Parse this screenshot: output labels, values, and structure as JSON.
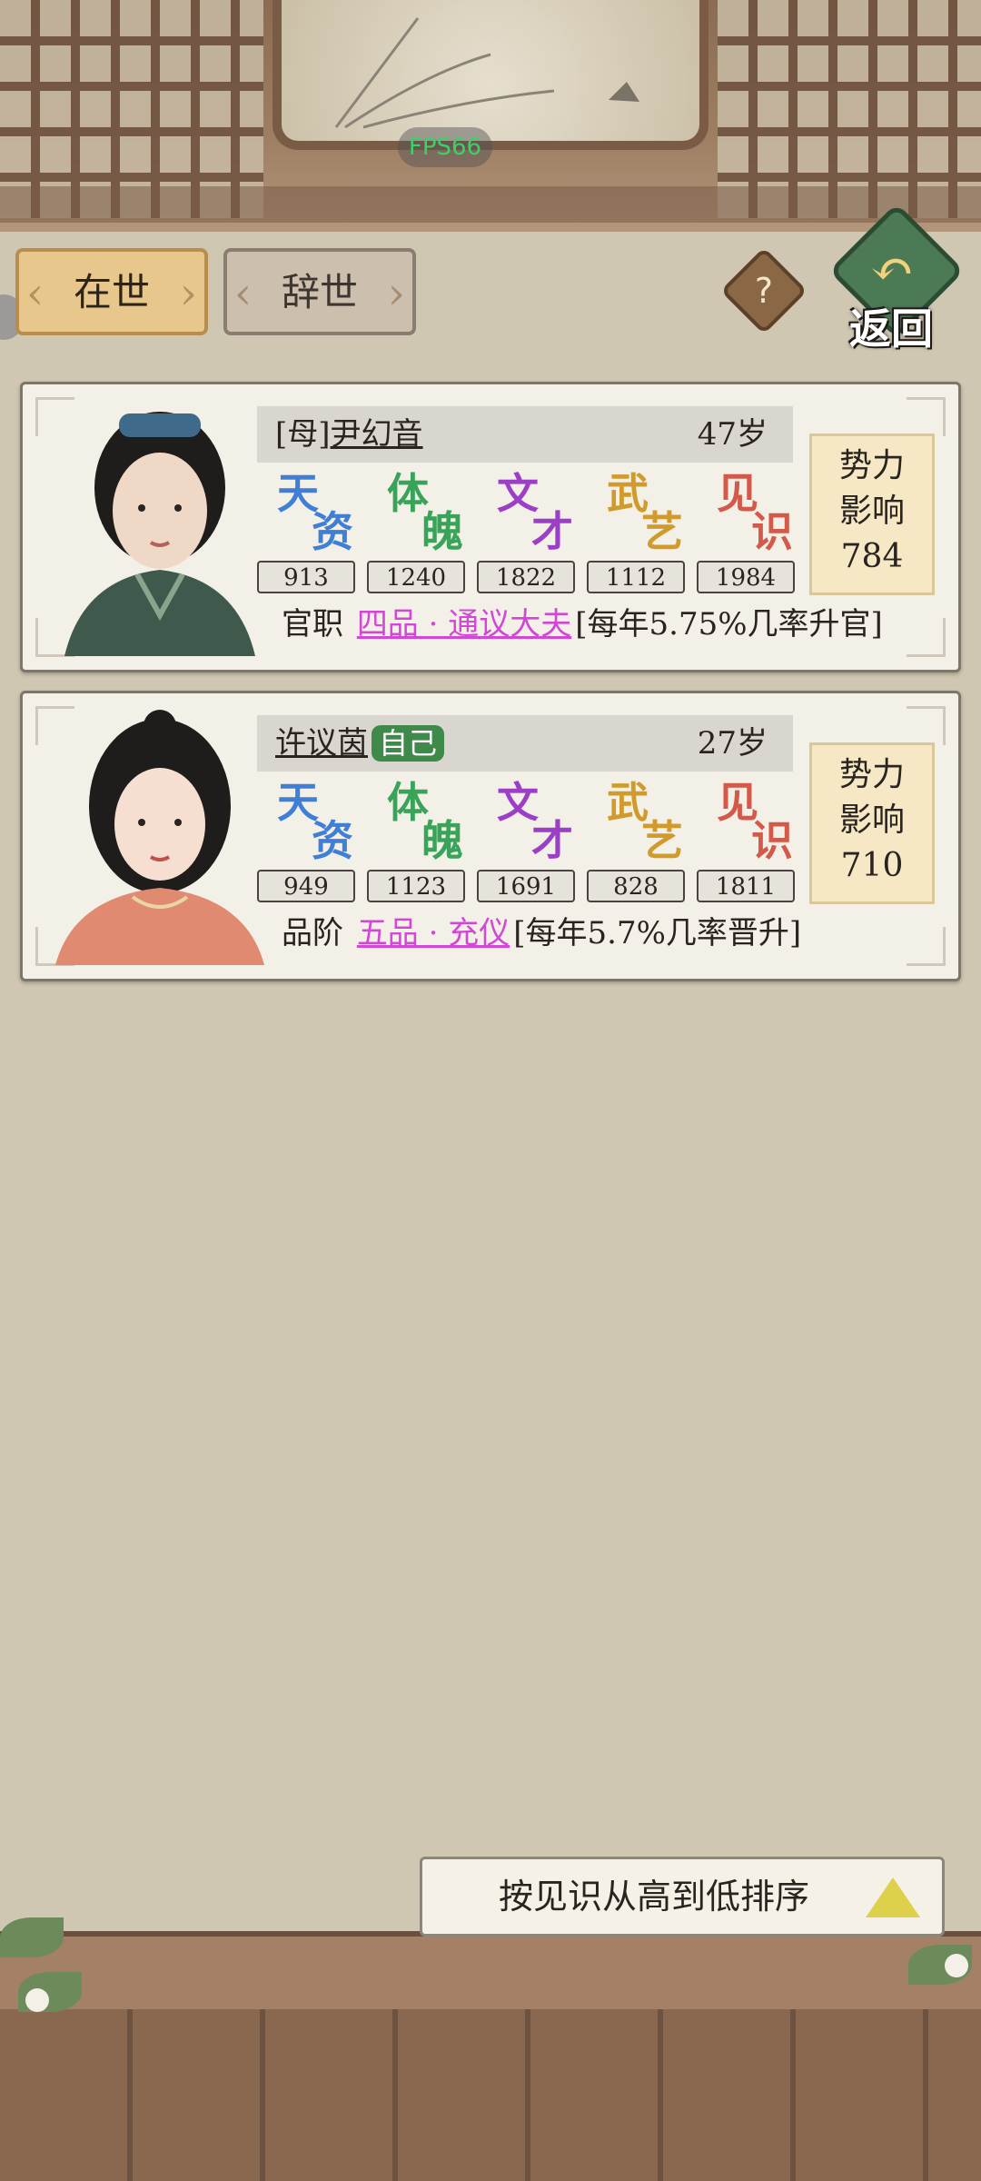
{
  "hud": {
    "fps": "FPS66"
  },
  "tabs": [
    {
      "label": "在世",
      "active": true
    },
    {
      "label": "辞世",
      "active": false
    }
  ],
  "help": {
    "label": "?"
  },
  "back": {
    "label": "返回"
  },
  "stat_labels": [
    {
      "top": "天",
      "bottom": "资",
      "color": "#3f7fd6"
    },
    {
      "top": "体",
      "bottom": "魄",
      "color": "#3aa35a"
    },
    {
      "top": "文",
      "bottom": "才",
      "color": "#9b3fc6"
    },
    {
      "top": "武",
      "bottom": "艺",
      "color": "#d09a2c"
    },
    {
      "top": "见",
      "bottom": "识",
      "color": "#d35a4a"
    }
  ],
  "characters": [
    {
      "relation": "[母]",
      "name": "尹幻音",
      "is_self": false,
      "age": "47岁",
      "stats": [
        "913",
        "1240",
        "1822",
        "1112",
        "1984"
      ],
      "title_label": "官职",
      "rank": "四品 · 通议大夫",
      "promotion": "[每年5.75%几率升官]",
      "power_title": "势力",
      "power_label": "影响",
      "power_value": "784"
    },
    {
      "relation": "",
      "name": "许议茵",
      "is_self": true,
      "self_tag": "自己",
      "age": "27岁",
      "stats": [
        "949",
        "1123",
        "1691",
        "828",
        "1811"
      ],
      "title_label": "品阶",
      "rank": "五品 · 充仪",
      "promotion": "[每年5.7%几率晋升]",
      "power_title": "势力",
      "power_label": "影响",
      "power_value": "710"
    }
  ],
  "sort": {
    "label": "按见识从高到低排序"
  }
}
